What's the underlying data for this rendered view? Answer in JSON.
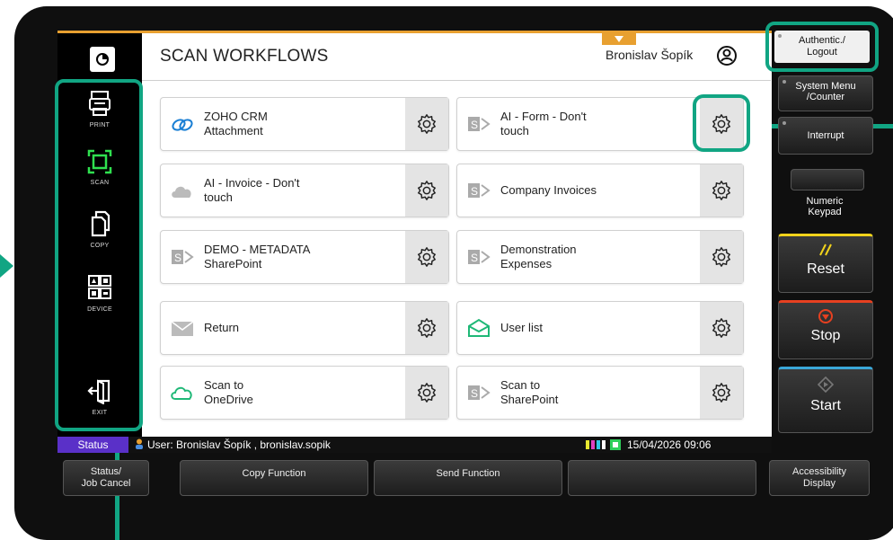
{
  "header": {
    "title": "SCAN WORKFLOWS",
    "user_name": "Bronislav Šopík"
  },
  "sidebar": {
    "items": [
      {
        "label": "PRINT",
        "icon": "print-icon"
      },
      {
        "label": "SCAN",
        "icon": "scan-icon"
      },
      {
        "label": "COPY",
        "icon": "copy-icon"
      },
      {
        "label": "DEVICE",
        "icon": "device-icon"
      },
      {
        "label": "EXIT",
        "icon": "exit-icon"
      }
    ]
  },
  "workflows": [
    {
      "line1": "ZOHO CRM",
      "line2": "Attachment",
      "icon": "zoho-icon"
    },
    {
      "line1": "AI - Form - Don't",
      "line2": "touch",
      "icon": "sharepoint-icon"
    },
    {
      "line1": "AI - Invoice - Don't",
      "line2": "touch",
      "icon": "cloud-icon"
    },
    {
      "line1": "Company Invoices",
      "line2": "",
      "icon": "sharepoint-icon"
    },
    {
      "line1": "DEMO - METADATA",
      "line2": "SharePoint",
      "icon": "sharepoint-icon"
    },
    {
      "line1": "Demonstration",
      "line2": "Expenses",
      "icon": "sharepoint-icon"
    },
    {
      "line1": "Return",
      "line2": "",
      "icon": "mail-icon"
    },
    {
      "line1": "User list",
      "line2": "",
      "icon": "envelope-open-icon"
    },
    {
      "line1": "Scan to",
      "line2": "OneDrive",
      "icon": "onedrive-icon"
    },
    {
      "line1": "Scan to",
      "line2": "SharePoint",
      "icon": "sharepoint-icon"
    }
  ],
  "right_panel": {
    "auth_line1": "Authentic./",
    "auth_line2": "Logout",
    "system_line1": "System Menu",
    "system_line2": "/Counter",
    "interrupt": "Interrupt",
    "numeric_line1": "Numeric",
    "numeric_line2": "Keypad",
    "reset": "Reset",
    "stop": "Stop",
    "start": "Start",
    "accessibility_line1": "Accessibility",
    "accessibility_line2": "Display"
  },
  "status_bar": {
    "status_label": "Status",
    "user_text": "User: Bronislav Šopík , bronislav.sopik",
    "datetime": "15/04/2026  09:06"
  },
  "bottom_bar": {
    "status_job_line1": "Status/",
    "status_job_line2": "Job Cancel",
    "copy_function": "Copy Function",
    "send_function": "Send Function"
  },
  "colors": {
    "highlight": "#11a583",
    "status_tag": "#5a30c8",
    "accent_tab": "#e8a030",
    "reset": "#f2d31b",
    "stop": "#e64020",
    "start": "#3aa7d8"
  }
}
